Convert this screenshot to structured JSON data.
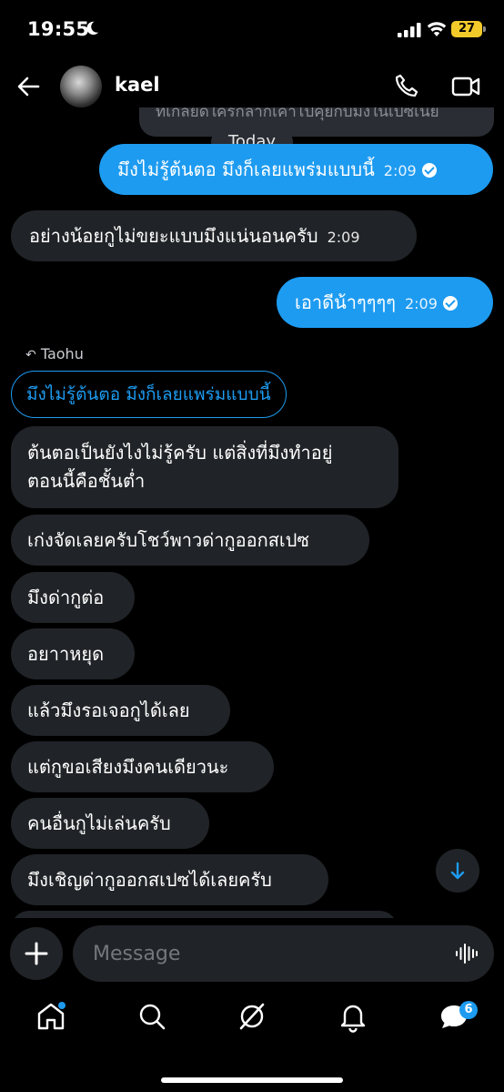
{
  "status_bar": {
    "time": "19:55",
    "battery": "27"
  },
  "header": {
    "contact_name": "kael"
  },
  "date_divider": "Today",
  "cut_off_text": "ที่เกลียดใครก็ลากเค้าไปคุยกับมึงในเปซเนย",
  "messages": [
    {
      "direction": "out",
      "text": "มึงไม่รู้ต้นตอ มึงก็เลยแพร่มแบบนี้",
      "time": "2:09"
    },
    {
      "direction": "in",
      "text": "อย่างน้อยกูไม่ขยะแบบมึงแน่นอนครับ",
      "time": "2:09"
    },
    {
      "direction": "out",
      "text": "เอาดีน้าๆๆๆๆ",
      "time": "2:09"
    }
  ],
  "reply": {
    "label": "Taohu",
    "quoted_text": "มึงไม่รู้ต้นตอ มึงก็เลยแพร่มแบบนี้"
  },
  "incoming": [
    "ต้นตอเป็นยังไงไม่รู้ครับ แต่สิ่งที่มึงทำอยู่",
    "ตอนนี้คือชั้นต่ำ",
    "เก่งจัดเลยครับโชว์พาวด่ากูออกสเปซ",
    "มึงด่ากูต่อ",
    "อยาาหยุด",
    "แล้วมึงรอเจอกูได้เลย",
    "แต่กูขอเสียงมึงคนเดียวนะ",
    "คนอื่นกูไม่เล่นครับ",
    "มึงเชิญด่ากูออกสเปซได้เลยครับ"
  ],
  "composer": {
    "placeholder": "Message"
  },
  "tabbar": {
    "messages_badge": "6"
  },
  "colors": {
    "accent": "#1d9bf0",
    "bubble_in": "#202327",
    "background": "#000000"
  }
}
